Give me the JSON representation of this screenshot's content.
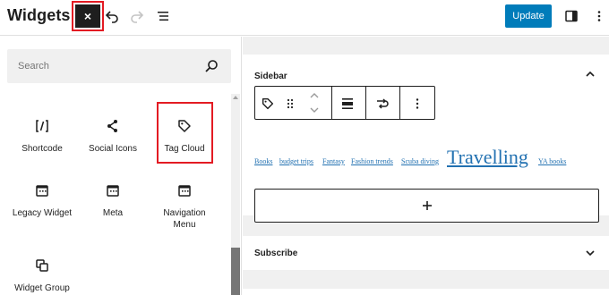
{
  "header": {
    "title": "Widgets",
    "close_label": "×",
    "update_label": "Update"
  },
  "inserter": {
    "search_placeholder": "Search",
    "blocks": [
      {
        "label": "Shortcode",
        "icon": "shortcode-icon"
      },
      {
        "label": "Social Icons",
        "icon": "share-icon"
      },
      {
        "label": "Tag Cloud",
        "icon": "tag-icon",
        "highlighted": true
      },
      {
        "label": "Legacy Widget",
        "icon": "calendar-icon"
      },
      {
        "label": "Meta",
        "icon": "calendar-icon"
      },
      {
        "label": "Navigation Menu",
        "icon": "calendar-icon"
      },
      {
        "label": "Widget Group",
        "icon": "group-icon"
      }
    ]
  },
  "canvas": {
    "sidebar_title": "Sidebar",
    "subscribe_title": "Subscribe",
    "tags": [
      "Books",
      "budget trips",
      "Fantasy",
      "Fashion trends",
      "Scuba diving",
      "Travelling",
      "YA books"
    ],
    "appender_label": "+"
  },
  "colors": {
    "accent": "#007cba",
    "highlight": "#e31b23",
    "link": "#2271b1",
    "dark": "#1e1e1e"
  }
}
